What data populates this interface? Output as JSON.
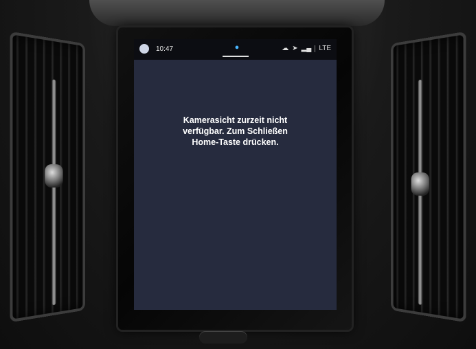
{
  "status_bar": {
    "time": "10:47",
    "network": "LTE",
    "icons": [
      "avatar-icon",
      "notification-icon",
      "cloud-icon",
      "navigation-icon",
      "signal-icon"
    ]
  },
  "main": {
    "message_line1": "Kamerasicht zurzeit nicht",
    "message_line2": "verfügbar. Zum Schließen",
    "message_line3": "Home-Taste drücken."
  },
  "colors": {
    "screen_bg": "#262b3e",
    "status_bg": "#0c0d12",
    "accent": "#49b6ff"
  }
}
